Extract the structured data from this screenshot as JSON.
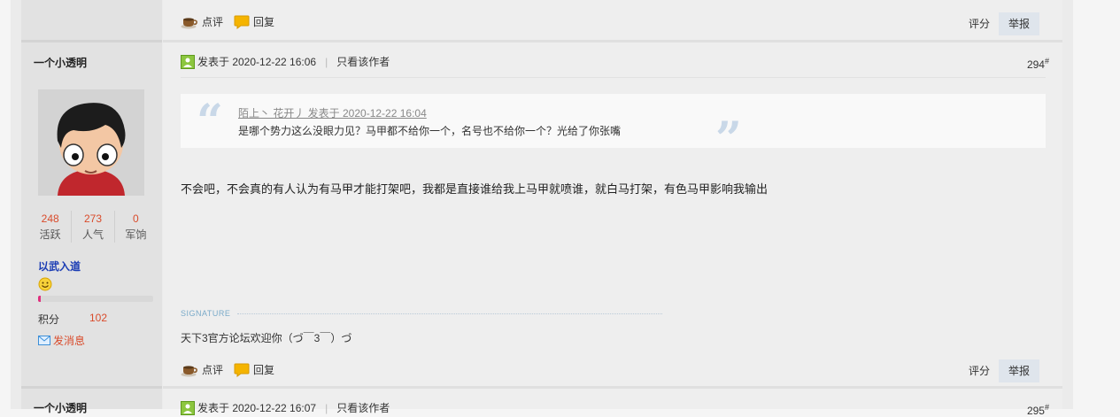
{
  "actions": {
    "comment": "点评",
    "reply": "回复",
    "rate": "评分",
    "report": "举报"
  },
  "post": {
    "user": {
      "name": "一个小透明",
      "stats": [
        {
          "value": "248",
          "label": "活跃"
        },
        {
          "value": "273",
          "label": "人气"
        },
        {
          "value": "0",
          "label": "军饷"
        }
      ],
      "group": "以武入道",
      "level_progress": 0.02,
      "points_label": "积分",
      "points_value": "102",
      "message_label": "发消息"
    },
    "meta": {
      "posted": "发表于 2020-12-22 16:06",
      "only_author": "只看该作者",
      "floor": "294",
      "floor_mark": "#"
    },
    "quote": {
      "open_mark": "“",
      "close_mark": "”",
      "header": "陌上丶 花开丿 发表于 2020-12-22 16:04",
      "text": "是哪个势力这么没眼力见？马甲都不给你一个，名号也不给你一个？光给了你张嘴"
    },
    "content": "不会吧，不会真的有人认为有马甲才能打架吧，我都是直接谁给我上马甲就喷谁，就白马打架，有色马甲影响我输出",
    "signature_label": "SIGNATURE",
    "signature": "天下3官方论坛欢迎你（づ￣3￣）づ"
  },
  "next_post": {
    "user_name": "一个小透明",
    "posted": "发表于 2020-12-22 16:07",
    "only_author": "只看该作者",
    "floor": "295",
    "floor_mark": "#"
  }
}
